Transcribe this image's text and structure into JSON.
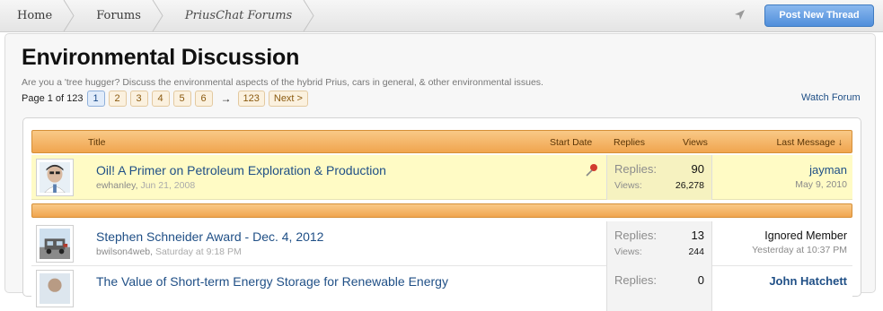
{
  "breadcrumb": {
    "items": [
      "Home",
      "Forums",
      "PriusChat Forums"
    ]
  },
  "header": {
    "post_button": "Post New Thread",
    "nav_icon": "navigation-arrow-icon"
  },
  "page": {
    "title": "Environmental Discussion",
    "description": "Are you a 'tree hugger? Discuss the environmental aspects of the hybrid Prius, cars in general, & other environmental issues.",
    "watch_link": "Watch Forum"
  },
  "pagination": {
    "label": "Page 1 of 123",
    "pages": [
      "1",
      "2",
      "3",
      "4",
      "5",
      "6"
    ],
    "current": "1",
    "arrow": "→",
    "last": "123",
    "next": "Next >"
  },
  "table": {
    "headers": {
      "title": "Title",
      "start_date": "Start Date",
      "replies": "Replies",
      "views": "Views",
      "last_message": "Last Message ↓"
    },
    "threads": [
      {
        "title": "Oil! A Primer on Petroleum Exploration & Production",
        "author": "ewhanley",
        "date": "Jun 21, 2008",
        "sticky": true,
        "replies_label": "Replies:",
        "replies": "90",
        "views_label": "Views:",
        "views": "26,278",
        "last_user": "jayman",
        "last_date": "May 9, 2010"
      },
      {
        "title": "Stephen Schneider Award - Dec. 4, 2012",
        "author": "bwilson4web",
        "date": "Saturday at 9:18 PM",
        "sticky": false,
        "replies_label": "Replies:",
        "replies": "13",
        "views_label": "Views:",
        "views": "244",
        "last_user": "Ignored Member",
        "last_date": "Yesterday at 10:37 PM"
      },
      {
        "title": "The Value of Short-term Energy Storage for Renewable Energy",
        "author": "",
        "date": "",
        "sticky": false,
        "replies_label": "Replies:",
        "replies": "0",
        "views_label": "",
        "views": "",
        "last_user": "John Hatchett",
        "last_date": ""
      }
    ]
  },
  "colors": {
    "header_orange": "#f0a54f",
    "sticky_bg": "#fffbc5",
    "link_blue": "#1f4f86",
    "button_blue": "#4f8edb"
  }
}
